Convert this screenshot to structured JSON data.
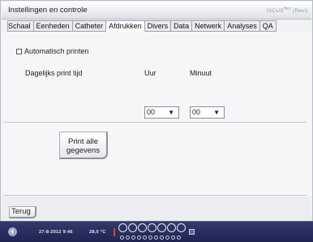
{
  "window": {
    "title": "Instellingen en controle",
    "brand": "ISCUS",
    "brand_sup": "flex",
    "brand_suffix": "(Rev1"
  },
  "tabs": [
    {
      "label": "Schaal",
      "active": false
    },
    {
      "label": "Eenheden",
      "active": false
    },
    {
      "label": "Catheter",
      "active": false
    },
    {
      "label": "Afdrukken",
      "active": true
    },
    {
      "label": "Divers",
      "active": false
    },
    {
      "label": "Data",
      "active": false
    },
    {
      "label": "Netwerk",
      "active": false
    },
    {
      "label": "Analyses",
      "active": false
    },
    {
      "label": "QA",
      "active": false
    }
  ],
  "print_settings": {
    "auto_print_label": "Automatisch printen",
    "auto_print_checked": false,
    "daily_time_label": "Dagelijks print tijd",
    "hour_label": "Uur",
    "minute_label": "Minuut",
    "hour_value": "00",
    "minute_value": "00",
    "caret": "▼",
    "print_all_label_line1": "Print alle",
    "print_all_label_line2": "gegevens"
  },
  "footer": {
    "back_label": "Terug"
  },
  "statusbar": {
    "datetime": "27-8-2012 9:46",
    "temperature": "28,0 °C",
    "large_circle_count": 7,
    "small_circle_count": 11
  },
  "colors": {
    "statusbar_bg": "#262d5e",
    "alert": "#e03a3a",
    "active_tab": "#ffffff"
  }
}
